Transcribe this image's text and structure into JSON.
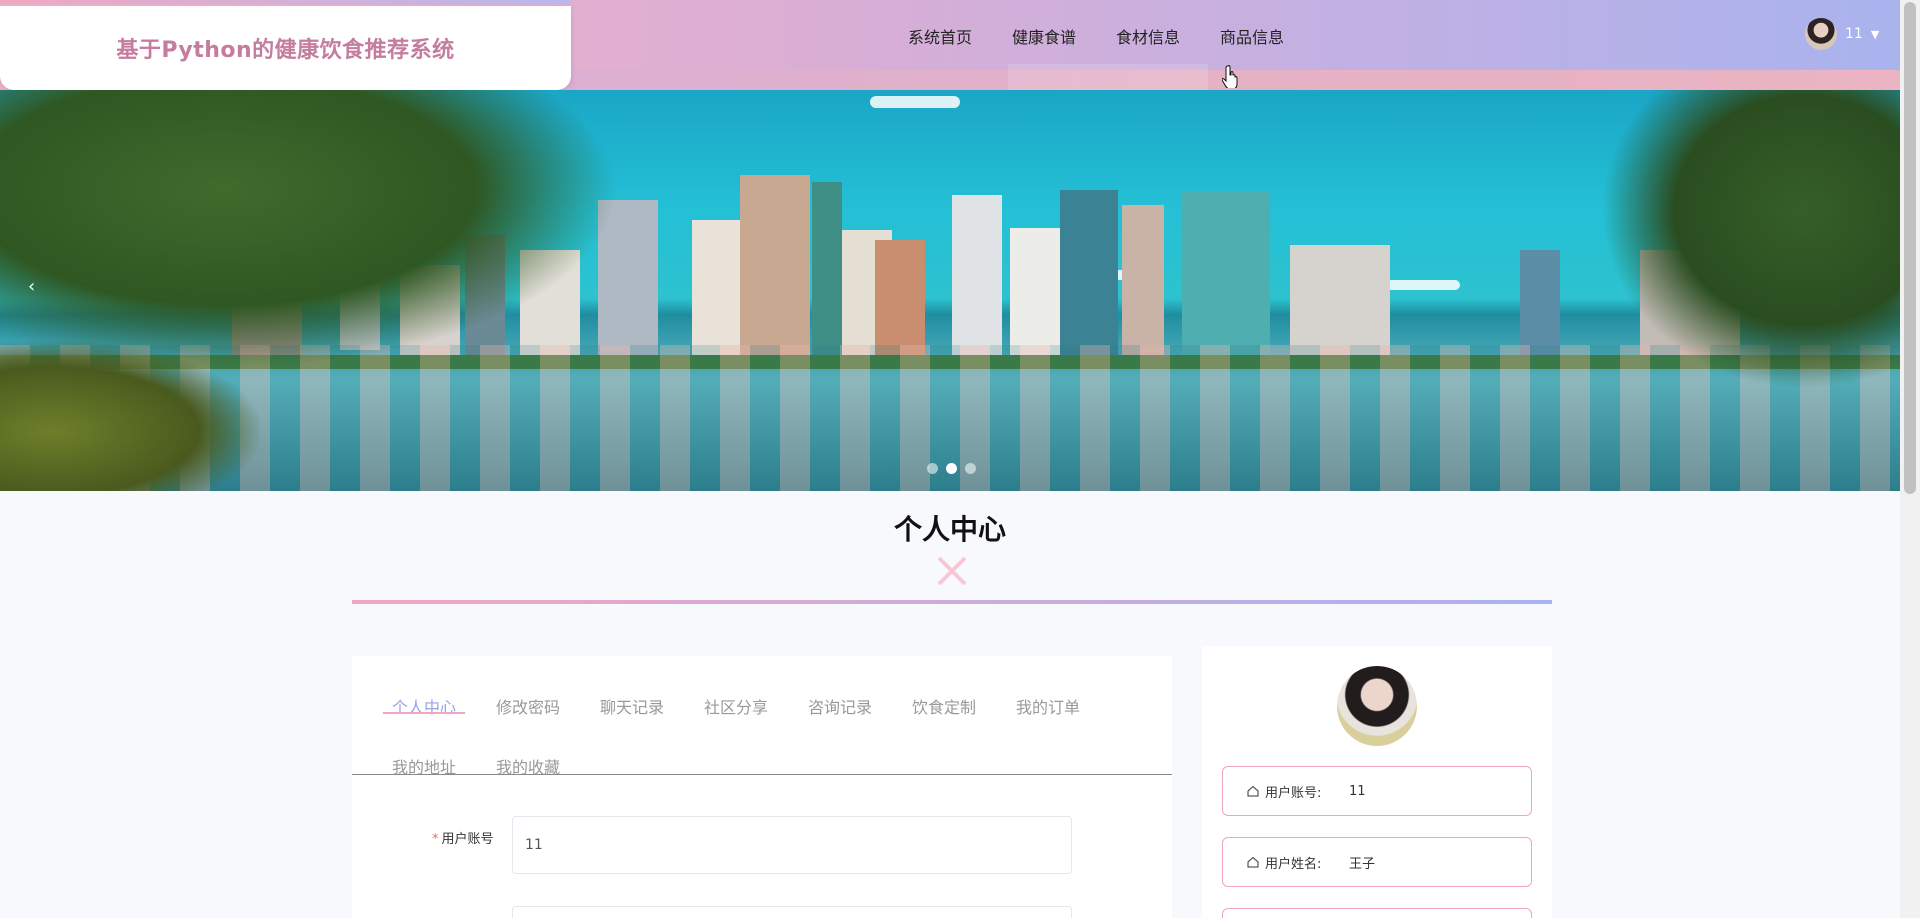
{
  "header": {
    "logo": "基于Python的健康饮食推荐系统",
    "nav": [
      "系统首页",
      "健康食谱",
      "食材信息",
      "商品信息"
    ],
    "user_name": "11"
  },
  "banner": {
    "prev_arrow": "‹",
    "dot_count": 3,
    "active_dot": 2
  },
  "section": {
    "title": "个人中心"
  },
  "tabs": {
    "items": [
      "个人中心",
      "修改密码",
      "聊天记录",
      "社区分享",
      "咨询记录",
      "饮食定制",
      "我的订单",
      "我的地址",
      "我的收藏"
    ],
    "active": "个人中心"
  },
  "form": {
    "account_label": "用户账号",
    "account_value": "11"
  },
  "profile": {
    "account_label": "用户账号:",
    "account_value": "11",
    "name_label": "用户姓名:",
    "name_value": "王子"
  },
  "colors": {
    "header_gradient_start": "#f2b3c8",
    "header_gradient_end": "#a9b3ee",
    "logo_text": "#c47d9e",
    "active_tab": "#97a4e6",
    "accent_pink": "#f0a8c2"
  }
}
